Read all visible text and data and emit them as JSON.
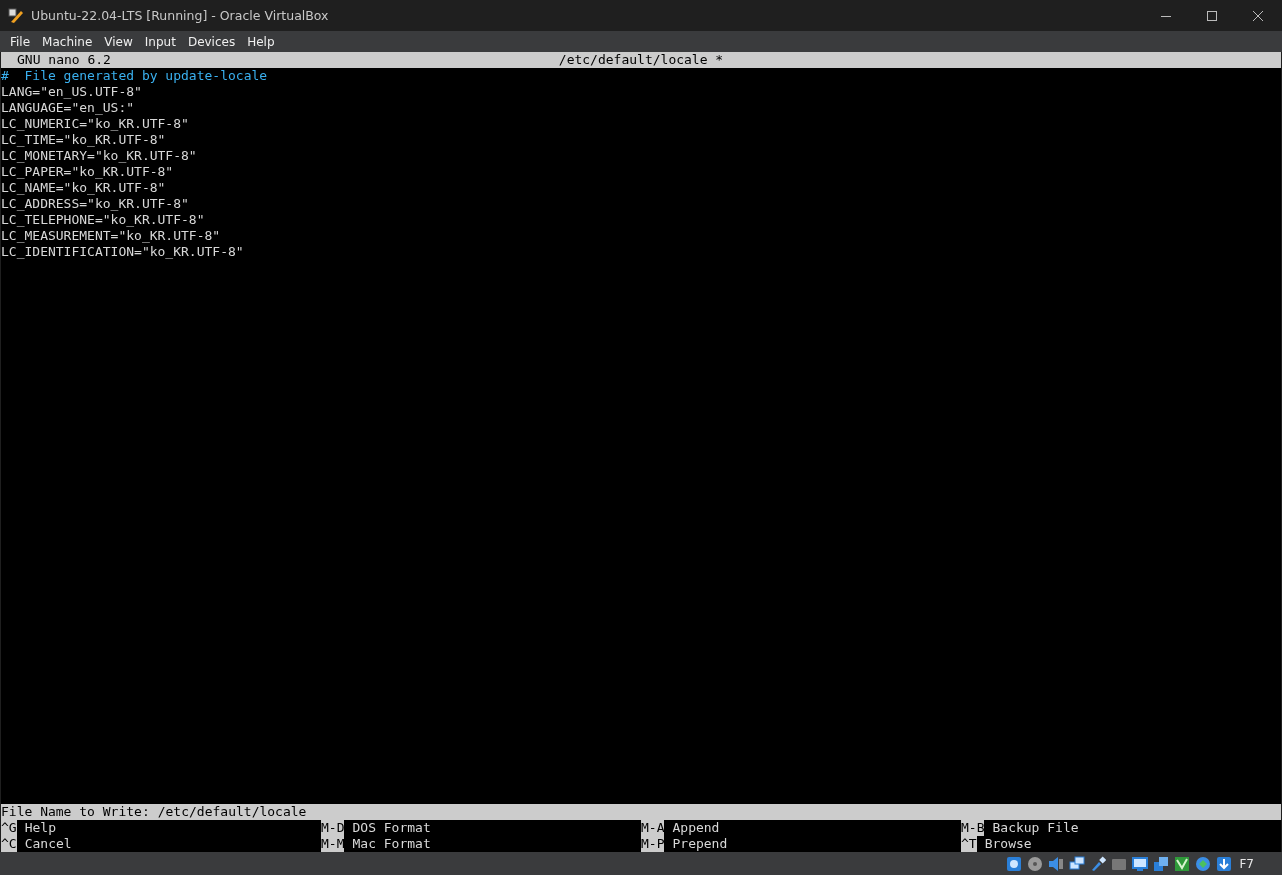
{
  "window": {
    "title": "Ubuntu-22.04-LTS [Running] - Oracle VirtualBox"
  },
  "menu": [
    "File",
    "Machine",
    "View",
    "Input",
    "Devices",
    "Help"
  ],
  "nano": {
    "header": {
      "app": "GNU nano 6.2",
      "filename": "/etc/default/locale *"
    },
    "lines": [
      {
        "kind": "comment",
        "text": "#  File generated by update-locale"
      },
      {
        "kind": "plain",
        "text": "LANG=\"en_US.UTF-8\""
      },
      {
        "kind": "plain",
        "text": "LANGUAGE=\"en_US:\""
      },
      {
        "kind": "plain",
        "text": "LC_NUMERIC=\"ko_KR.UTF-8\""
      },
      {
        "kind": "plain",
        "text": "LC_TIME=\"ko_KR.UTF-8\""
      },
      {
        "kind": "plain",
        "text": "LC_MONETARY=\"ko_KR.UTF-8\""
      },
      {
        "kind": "plain",
        "text": "LC_PAPER=\"ko_KR.UTF-8\""
      },
      {
        "kind": "plain",
        "text": "LC_NAME=\"ko_KR.UTF-8\""
      },
      {
        "kind": "plain",
        "text": "LC_ADDRESS=\"ko_KR.UTF-8\""
      },
      {
        "kind": "plain",
        "text": "LC_TELEPHONE=\"ko_KR.UTF-8\""
      },
      {
        "kind": "plain",
        "text": "LC_MEASUREMENT=\"ko_KR.UTF-8\""
      },
      {
        "kind": "plain",
        "text": "LC_IDENTIFICATION=\"ko_KR.UTF-8\""
      }
    ],
    "prompt": {
      "label": "File Name to Write:",
      "value": "/etc/default/locale"
    },
    "shortcuts": [
      {
        "key": "^G",
        "label": "Help"
      },
      {
        "key": "M-D",
        "label": "DOS Format"
      },
      {
        "key": "M-A",
        "label": "Append"
      },
      {
        "key": "M-B",
        "label": "Backup File"
      },
      {
        "key": "^C",
        "label": "Cancel"
      },
      {
        "key": "M-M",
        "label": "Mac Format"
      },
      {
        "key": "M-P",
        "label": "Prepend"
      },
      {
        "key": "^T",
        "label": "Browse"
      }
    ]
  },
  "status_bar": {
    "host_key": "F7"
  }
}
